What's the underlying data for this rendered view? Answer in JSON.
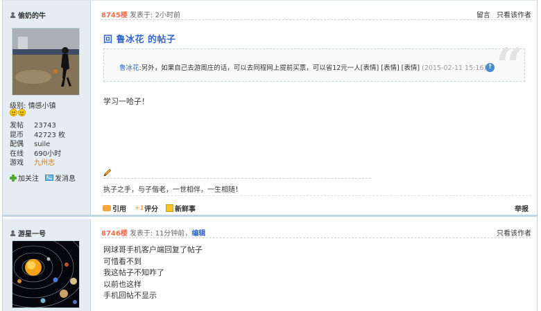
{
  "posts": [
    {
      "username": "偷奶的牛",
      "level_label": "级别:",
      "level_value": "情感小镇",
      "stats": [
        {
          "key": "发帖",
          "value": "23743"
        },
        {
          "key": "昆币",
          "value": "42723 枚"
        },
        {
          "key": "配偶",
          "value": "suile"
        },
        {
          "key": "在线",
          "value": "690小时"
        },
        {
          "key": "游戏",
          "value": "九州志"
        }
      ],
      "follow_label": "加关注",
      "message_label": "发消息",
      "floor": "8745楼",
      "posted": "发表于: 2小时前",
      "reply_label": "留言",
      "only_author_label": "只看该作者",
      "title": "回 鲁冰花 的帖子",
      "quote": {
        "author": "鲁冰花",
        "text": ":另外，如果自己去游周庄的话，可以去同程网上提前买票，可以省12元一人[表情] [表情] [表情]",
        "time": "(2015-02-11 15:16)",
        "badge": "↑"
      },
      "body": "学习一哈子！",
      "signature": "执子之手，与子偕老，一世相伴，一生相随！",
      "actions": {
        "quote": "引用",
        "rate": "评分",
        "fresh": "新鲜事",
        "report": "举报"
      }
    },
    {
      "username": "游星一号",
      "floor": "8746楼",
      "posted": "发表于: 11分钟前，",
      "edit_label": "编辑",
      "only_author_label": "只看该作者",
      "body_lines": [
        "网球哥手机客户端回复了帖子",
        "可惜看不到",
        "我这帖子不知咋了",
        "以前也这样",
        "手机回帖不显示"
      ]
    }
  ],
  "colors": {
    "floor": "#f26c4f",
    "link": "#3366cc",
    "sidebar": "#e5edf2",
    "border": "#c2d5e3"
  }
}
